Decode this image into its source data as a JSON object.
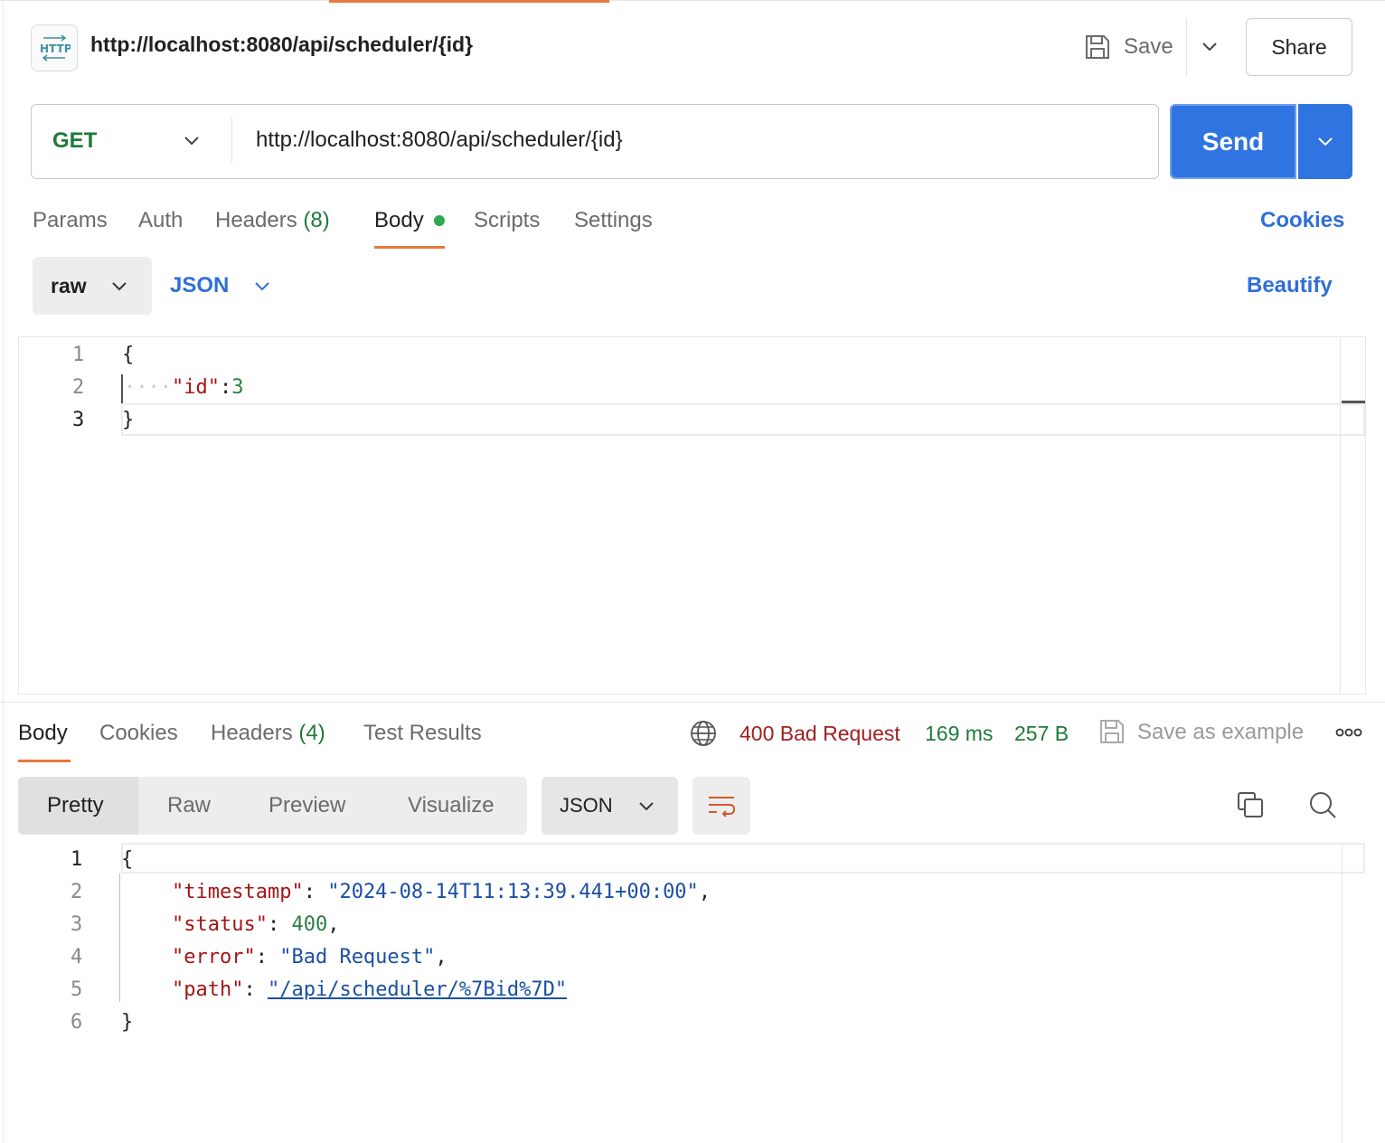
{
  "header": {
    "icon": "http-icon",
    "title": "http://localhost:8080/api/scheduler/{id}",
    "save_label": "Save",
    "share_label": "Share"
  },
  "request": {
    "method": "GET",
    "url": "http://localhost:8080/api/scheduler/{id}",
    "send_label": "Send",
    "tabs": [
      {
        "label": "Params"
      },
      {
        "label": "Auth"
      },
      {
        "label": "Headers",
        "count": "(8)"
      },
      {
        "label": "Body",
        "active": true
      },
      {
        "label": "Scripts"
      },
      {
        "label": "Settings"
      }
    ],
    "cookies_label": "Cookies",
    "body_mode": "raw",
    "body_format": "JSON",
    "beautify_label": "Beautify",
    "editor": {
      "line_numbers": [
        "1",
        "2",
        "3"
      ],
      "lines": {
        "l1": "{",
        "l2_indent": "····",
        "l2_key": "\"id\"",
        "l2_colon": ":",
        "l2_value": "3",
        "l3": "}"
      }
    }
  },
  "response": {
    "tabs": [
      {
        "label": "Body",
        "active": true
      },
      {
        "label": "Cookies"
      },
      {
        "label": "Headers",
        "count": "(4)"
      },
      {
        "label": "Test Results"
      }
    ],
    "status": "400 Bad Request",
    "time": "169 ms",
    "size": "257 B",
    "save_example_label": "Save as example",
    "view_options": [
      "Pretty",
      "Raw",
      "Preview",
      "Visualize"
    ],
    "active_view": "Pretty",
    "format": "JSON",
    "colors": {
      "status_error": "#a02020",
      "ok_green": "#1f7a3a",
      "accent": "#e8793d",
      "primary": "#2f74e0"
    },
    "editor": {
      "line_numbers": [
        "1",
        "2",
        "3",
        "4",
        "5",
        "6"
      ],
      "open": "{",
      "close": "}",
      "fields": [
        {
          "key": "\"timestamp\"",
          "value": "\"2024-08-14T11:13:39.441+00:00\"",
          "type": "string"
        },
        {
          "key": "\"status\"",
          "value": "400",
          "type": "number"
        },
        {
          "key": "\"error\"",
          "value": "\"Bad Request\"",
          "type": "string"
        },
        {
          "key": "\"path\"",
          "value": "\"/api/scheduler/%7Bid%7D\"",
          "type": "link"
        }
      ]
    }
  }
}
